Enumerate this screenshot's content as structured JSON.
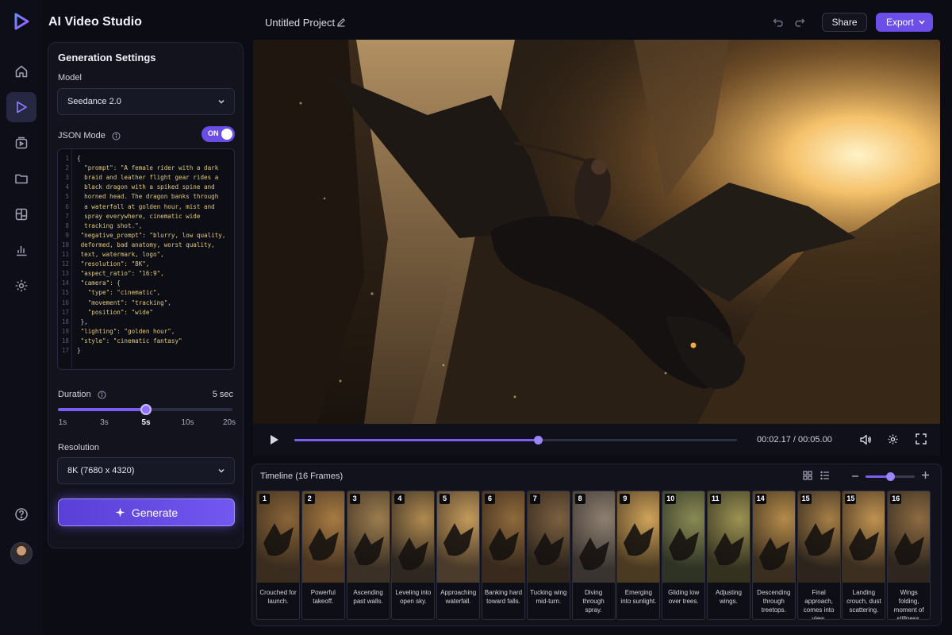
{
  "app": {
    "title": "AI Video Studio"
  },
  "rail": {
    "items": [
      {
        "name": "home",
        "active": false
      },
      {
        "name": "video",
        "active": true
      },
      {
        "name": "media",
        "active": false
      },
      {
        "name": "folder",
        "active": false
      },
      {
        "name": "templates",
        "active": false
      },
      {
        "name": "analytics",
        "active": false
      },
      {
        "name": "settings",
        "active": false
      }
    ]
  },
  "settings": {
    "title": "Generation Settings",
    "model_label": "Model",
    "model_value": "Seedance 2.0",
    "json_mode_label": "JSON Mode",
    "json_mode_toggle": "ON",
    "code_lines": [
      {
        "n": "1",
        "t": "{"
      },
      {
        "n": "2",
        "t": "  \"prompt\": \"A female rider with a dark"
      },
      {
        "n": "3",
        "t": "  braid and leather flight gear rides a"
      },
      {
        "n": "4",
        "t": "  black dragon with a spiked spine and"
      },
      {
        "n": "5",
        "t": "  horned head. The dragon banks through"
      },
      {
        "n": "6",
        "t": "  a waterfall at golden hour, mist and"
      },
      {
        "n": "7",
        "t": "  spray everywhere, cinematic wide"
      },
      {
        "n": "8",
        "t": "  tracking shot.\","
      },
      {
        "n": "9",
        "t": " \"negative_prompt\": \"blurry, low quality,"
      },
      {
        "n": "10",
        "t": " deformed, bad anatomy, worst quality,"
      },
      {
        "n": "11",
        "t": " text, watermark, logo\","
      },
      {
        "n": "12",
        "t": " \"resolution\": \"8K\","
      },
      {
        "n": "13",
        "t": " \"aspect_ratio\": \"16:9\","
      },
      {
        "n": "14",
        "t": " \"camera\": {"
      },
      {
        "n": "15",
        "t": "   \"type\": \"cinematic\","
      },
      {
        "n": "16",
        "t": "   \"movement\": \"tracking\","
      },
      {
        "n": "17",
        "t": "   \"position\": \"wide\""
      },
      {
        "n": "18",
        "t": " },"
      },
      {
        "n": "19",
        "t": " \"lighting\": \"golden hour\","
      },
      {
        "n": "18",
        "t": " \"style\": \"cinematic fantasy\""
      },
      {
        "n": "17",
        "t": "}"
      }
    ],
    "duration_label": "Duration",
    "duration_value": "5 sec",
    "duration_ticks": [
      "1s",
      "3s",
      "5s",
      "10s",
      "20s"
    ],
    "duration_selected": "5s",
    "resolution_label": "Resolution",
    "resolution_value": "8K (7680 x 4320)",
    "generate_label": "Generate"
  },
  "topbar": {
    "project_name": "Untitled Project",
    "share_label": "Share",
    "export_label": "Export"
  },
  "player": {
    "time": "00:02.17 / 00:05.00",
    "progress": 0.55
  },
  "timeline": {
    "title": "Timeline (16 Frames)",
    "zoom_level": 0.5,
    "frames": [
      {
        "num": "1",
        "caption": "Crouched for launch."
      },
      {
        "num": "2",
        "caption": "Powerful takeoff."
      },
      {
        "num": "3",
        "caption": "Ascending past walls."
      },
      {
        "num": "4",
        "caption": "Leveling into open sky."
      },
      {
        "num": "5",
        "caption": "Approaching waterfall."
      },
      {
        "num": "6",
        "caption": "Banking hard toward falls."
      },
      {
        "num": "7",
        "caption": "Tucking wing mid-turn."
      },
      {
        "num": "8",
        "caption": "Diving through spray."
      },
      {
        "num": "9",
        "caption": "Emerging into sunlight."
      },
      {
        "num": "10",
        "caption": "Gliding low over trees."
      },
      {
        "num": "11",
        "caption": "Adjusting wings."
      },
      {
        "num": "14",
        "caption": "Descending through treetops."
      },
      {
        "num": "15",
        "caption": "Final approach, comes into view."
      },
      {
        "num": "15",
        "caption": "Landing crouch, dust scattering."
      },
      {
        "num": "16",
        "caption": "Wings folding, moment of stillness."
      }
    ]
  },
  "colors": {
    "accent": "#7b5cf5",
    "background": "#0b0c14",
    "panel": "#12131d"
  }
}
